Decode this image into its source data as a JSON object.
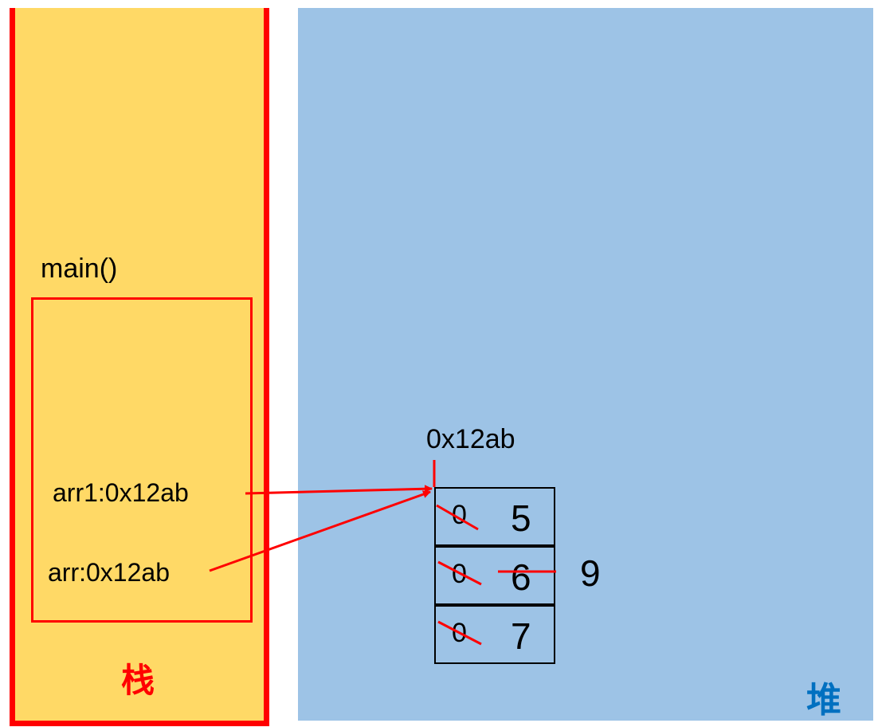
{
  "stack": {
    "label": "栈",
    "frame_title": "main()",
    "vars": [
      {
        "text": "arr1:0x12ab"
      },
      {
        "text": "arr:0x12ab"
      }
    ]
  },
  "heap": {
    "label": "堆",
    "array_address": "0x12ab",
    "cells": [
      {
        "old": "0",
        "new": "5"
      },
      {
        "old": "0",
        "new": "6",
        "changed_to": "9"
      },
      {
        "old": "0",
        "new": "7"
      }
    ]
  },
  "colors": {
    "stack_bg": "#ffd966",
    "heap_bg": "#9dc3e6",
    "accent_red": "#ff0000",
    "heap_label": "#0070c0"
  }
}
